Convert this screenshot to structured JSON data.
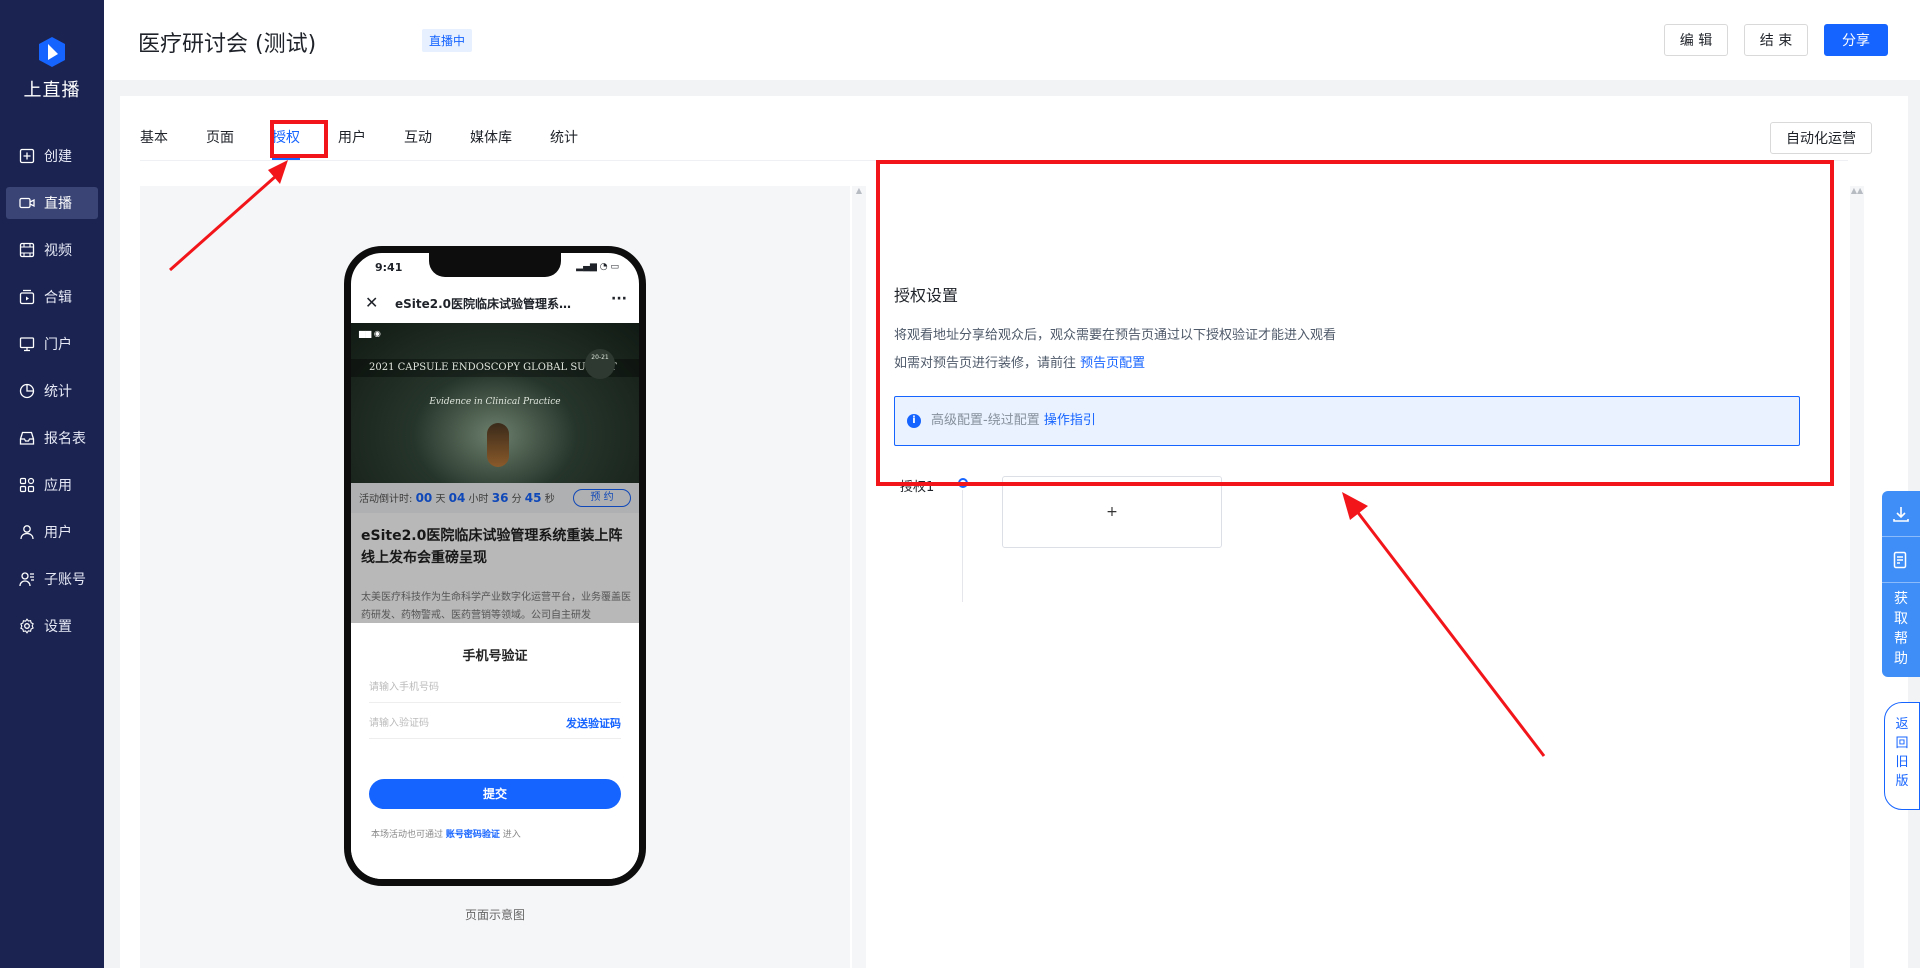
{
  "sidebar": {
    "logo_text": "上直播",
    "items": [
      {
        "label": "创建",
        "icon": "plus-square-icon"
      },
      {
        "label": "直播",
        "icon": "video-camera-icon"
      },
      {
        "label": "视频",
        "icon": "film-icon"
      },
      {
        "label": "合辑",
        "icon": "collection-icon"
      },
      {
        "label": "门户",
        "icon": "monitor-icon"
      },
      {
        "label": "统计",
        "icon": "pie-chart-icon"
      },
      {
        "label": "报名表",
        "icon": "inbox-icon"
      },
      {
        "label": "应用",
        "icon": "apps-icon"
      },
      {
        "label": "用户",
        "icon": "user-icon"
      },
      {
        "label": "子账号",
        "icon": "sub-account-icon"
      },
      {
        "label": "设置",
        "icon": "gear-icon"
      }
    ],
    "active_index": 1
  },
  "header": {
    "title": "医疗研讨会 (测试)",
    "status_badge": "直播中",
    "edit_label": "编 辑",
    "end_label": "结 束",
    "share_label": "分享"
  },
  "tabs": [
    {
      "label": "基本"
    },
    {
      "label": "页面"
    },
    {
      "label": "授权"
    },
    {
      "label": "用户"
    },
    {
      "label": "互动"
    },
    {
      "label": "媒体库"
    },
    {
      "label": "统计"
    }
  ],
  "active_tab_index": 2,
  "auto_ops_label": "自动化运营",
  "preview": {
    "status_time": "9:41",
    "page_title": "eSite2.0医院临床试验管理系统重装上阵线上发布会重磅呈现",
    "banner_headline": "2021  CAPSULE ENDOSCOPY GLOBAL SUMMIT",
    "banner_sub": "Evidence in Clinical Practice",
    "banner_date": "20-21",
    "countdown_label": "活动倒计时:",
    "countdown": {
      "days": "00",
      "hours": "04",
      "minutes": "36",
      "seconds": "45"
    },
    "countdown_units": {
      "days": "天",
      "hours": "小时",
      "minutes": "分",
      "seconds": "秒"
    },
    "reserve_label": "预 约",
    "article_title": "eSite2.0医院临床试验管理系统重装上阵线上发布会重磅呈现",
    "article_desc": "太美医疗科技作为生命科学产业数字化运营平台，业务覆盖医药研发、药物警戒、医药营销等领域。公司自主研发",
    "sheet_title": "手机号验证",
    "phone_placeholder": "请输入手机号码",
    "code_placeholder": "请输入验证码",
    "send_code_label": "发送验证码",
    "submit_label": "提交",
    "foot_prefix": "本场活动也可通过",
    "foot_link": "账号密码验证",
    "foot_suffix": "进入",
    "caption": "页面示意图"
  },
  "auth": {
    "title": "授权设置",
    "desc_line1": "将观看地址分享给观众后，观众需要在预告页通过以下授权验证才能进入观看",
    "desc_line2_prefix": "如需对预告页进行装修，请前往",
    "desc_line2_link": "预告页配置",
    "info_text": "高级配置-绕过配置",
    "info_link": "操作指引",
    "item_label": "授权1",
    "add_label": "+"
  },
  "float_help": {
    "label": "获取帮助"
  },
  "float_old": {
    "label": "返回旧版"
  },
  "colors": {
    "sidebar": "#1b2451",
    "accent": "#1664ff",
    "annotation": "#f2161b"
  }
}
